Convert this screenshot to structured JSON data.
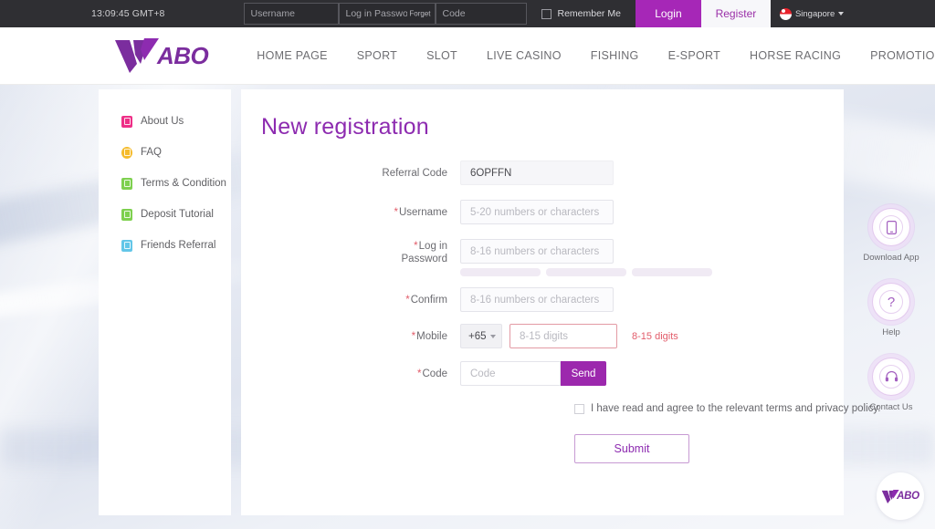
{
  "topbar": {
    "clock": "13:09:45 GMT+8",
    "username_placeholder": "Username",
    "password_placeholder": "Log in Password",
    "forget_label": "Forget",
    "code_placeholder": "Code",
    "remember_label": "Remember Me",
    "login_label": "Login",
    "register_label": "Register",
    "locale_label": "Singapore",
    "locale_flag": "singapore-flag-icon"
  },
  "header": {
    "logo_text": "ABO",
    "logo_full": "WABO",
    "nav": [
      {
        "label": "HOME PAGE"
      },
      {
        "label": "SPORT"
      },
      {
        "label": "SLOT"
      },
      {
        "label": "LIVE CASINO"
      },
      {
        "label": "FISHING"
      },
      {
        "label": "E-SPORT"
      },
      {
        "label": "HORSE RACING"
      },
      {
        "label": "PROMOTION"
      }
    ]
  },
  "sidebar": {
    "items": [
      {
        "label": "About Us",
        "icon": "book-icon",
        "color": "#ee2f87"
      },
      {
        "label": "FAQ",
        "icon": "question-icon",
        "color": "#f5bb2b"
      },
      {
        "label": "Terms & Condition",
        "icon": "document-icon",
        "color": "#7ed04f"
      },
      {
        "label": "Deposit Tutorial",
        "icon": "deposit-icon",
        "color": "#7ed04f"
      },
      {
        "label": "Friends Referral",
        "icon": "friends-icon",
        "color": "#63c6e8"
      }
    ]
  },
  "form": {
    "title": "New registration",
    "referral": {
      "label": "Referral Code",
      "value": "6OPFFN"
    },
    "username": {
      "label": "* Username",
      "placeholder": "5-20 numbers or characters"
    },
    "password": {
      "label": "* Log in\nPassword",
      "placeholder": "8-16 numbers or characters"
    },
    "confirm": {
      "label": "* Confirm",
      "placeholder": "8-16 numbers or characters"
    },
    "mobile": {
      "label": "* Mobile",
      "country_code": "+65",
      "placeholder": "8-15 digits",
      "error": "8-15 digits"
    },
    "code": {
      "label": "* Code",
      "placeholder": "Code",
      "send_label": "Send"
    },
    "terms_text": "I have read and agree to the relevant terms and privacy policy.",
    "submit_label": "Submit"
  },
  "widgets": [
    {
      "label": "Download App",
      "icon": "mobile-phone-icon"
    },
    {
      "label": "Help",
      "icon": "question-mark-icon"
    },
    {
      "label": "Contact Us",
      "icon": "headset-icon"
    }
  ],
  "brand_badge": {
    "text": "ABO"
  },
  "colors": {
    "brand_purple": "#8d2bb0",
    "login_purple": "#a627b7",
    "error_red": "#e25c6a",
    "topbar_dark": "#2f2f33"
  }
}
